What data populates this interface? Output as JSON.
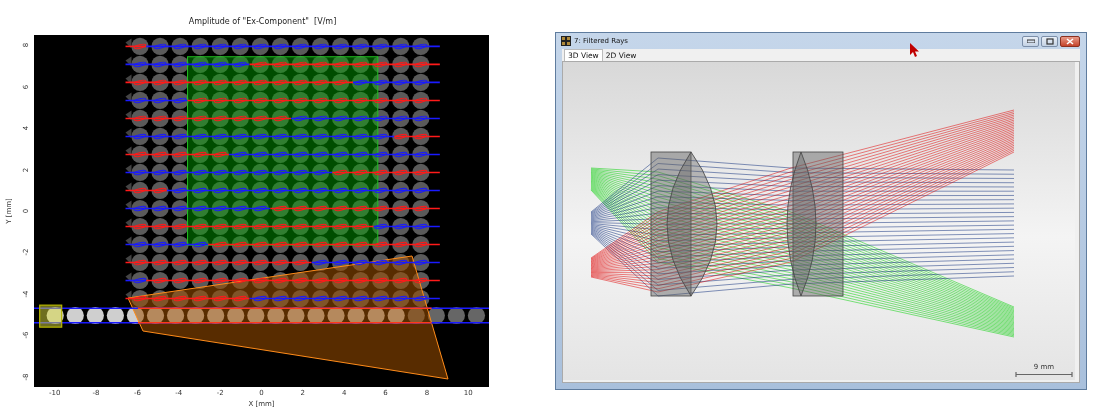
{
  "plot": {
    "title": "Amplitude of \"Ex-Component\"  [V/m]",
    "xlabel": "X [mm]",
    "ylabel": "Y [mm]",
    "xticks": [
      "-10",
      "-8",
      "-6",
      "-4",
      "-2",
      "0",
      "2",
      "4",
      "6",
      "8",
      "10"
    ],
    "yticks": [
      "8",
      "6",
      "4",
      "2",
      "0",
      "-2",
      "-4",
      "-6",
      "-8"
    ]
  },
  "window": {
    "title": "7: Filtered Rays",
    "tabs": [
      {
        "label": "3D View",
        "selected": true
      },
      {
        "label": "2D View",
        "selected": false
      }
    ],
    "scale_bar": "9 mm"
  }
}
